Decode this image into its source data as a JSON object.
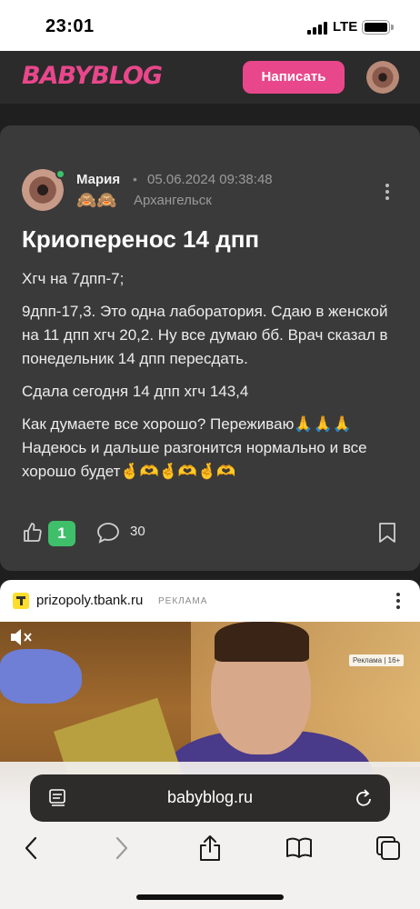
{
  "status_bar": {
    "time": "23:01",
    "network": "LTE"
  },
  "header": {
    "logo": "BABYBLOG",
    "write_button": "Написать",
    "brand_color": "#e8478b"
  },
  "post": {
    "author": "Мария",
    "separator": "•",
    "date": "05.06.2024 09:38:48",
    "badges": "🙈🙈",
    "city": "Архангельск",
    "title": "Криоперенос 14 дпп",
    "paragraphs": [
      "Хгч на 7дпп-7;",
      "9дпп-17,3. Это одна лаборатория. Сдаю в женской на 11 дпп хгч 20,2. Ну все думаю бб. Врач сказал в понедельник 14 дпп пересдать.",
      "Сдала сегодня 14 дпп хгч 143,4",
      "Как думаете все хорошо? Переживаю🙏🙏🙏 Надеюсь и дальше разгонится нормально и все хорошо будет🤞🫶🤞🫶🤞🫶"
    ],
    "likes": "1",
    "comments": "30",
    "icons": {
      "like": "thumbs-up-icon",
      "comment": "comment-bubble-icon",
      "bookmark": "bookmark-icon",
      "more": "more-vertical-icon"
    }
  },
  "ad": {
    "domain": "prizopoly.tbank.ru",
    "label": "РЕКЛАМА",
    "video_badge": "Реклама | 16+"
  },
  "browser": {
    "url": "babyblog.ru",
    "icons": [
      "back-icon",
      "forward-icon",
      "share-icon",
      "bookmarks-icon",
      "tabs-icon"
    ]
  }
}
